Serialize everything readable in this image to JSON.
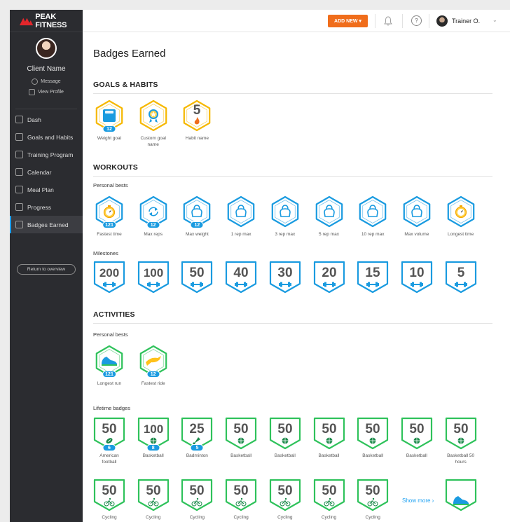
{
  "brand": {
    "name": "PEAK FITNESS",
    "color": "#e3262b"
  },
  "client": {
    "name": "Client Name",
    "message": "Message",
    "view_profile": "View Profile"
  },
  "nav": [
    {
      "label": "Dash",
      "icon": "rocket-icon"
    },
    {
      "label": "Goals and Habits",
      "icon": "target-icon"
    },
    {
      "label": "Training Program",
      "icon": "clipboard-icon"
    },
    {
      "label": "Calendar",
      "icon": "calendar-icon"
    },
    {
      "label": "Meal Plan",
      "icon": "utensils-icon"
    },
    {
      "label": "Progress",
      "icon": "chart-icon"
    },
    {
      "label": "Badges Earned",
      "icon": "grid-icon"
    }
  ],
  "return_label": "Return to overview",
  "topbar": {
    "add_new": "ADD NEW ▾",
    "help": "?",
    "trainer": "Trainer O.",
    "chevron": "⌄"
  },
  "page_title": "Badges Earned",
  "colors": {
    "blue": "#1a9be0",
    "yellow": "#f6b800",
    "green": "#2fc25b",
    "orange": "#f06d1b"
  },
  "goals": {
    "heading": "GOALS & HABITS",
    "badges": [
      {
        "label": "Weight goal",
        "icon": "scale-icon",
        "count": "12"
      },
      {
        "label": "Custom goal name",
        "icon": "award-icon",
        "count": ""
      },
      {
        "label": "Habit name",
        "icon": "flame-icon",
        "number": "5"
      }
    ]
  },
  "workouts": {
    "heading": "WORKOUTS",
    "personal_heading": "Personal bests",
    "personal": [
      {
        "label": "Fastest time",
        "icon": "stopwatch-icon",
        "count": "121"
      },
      {
        "label": "Max reps",
        "icon": "repeat-icon",
        "count": "12"
      },
      {
        "label": "Max weight",
        "icon": "kettlebell-icon",
        "count": "12"
      },
      {
        "label": "1 rep max",
        "icon": "kettlebell-icon"
      },
      {
        "label": "3 rep max",
        "icon": "kettlebell-icon"
      },
      {
        "label": "5 rep max",
        "icon": "kettlebell-icon"
      },
      {
        "label": "10 rep max",
        "icon": "kettlebell-icon"
      },
      {
        "label": "Max volume",
        "icon": "kettlebell-icon"
      },
      {
        "label": "Longest time",
        "icon": "stopwatch-icon"
      }
    ],
    "milestones_heading": "Milestones",
    "milestones": [
      "200",
      "100",
      "50",
      "40",
      "30",
      "20",
      "15",
      "10",
      "5"
    ]
  },
  "activities": {
    "heading": "ACTIVITIES",
    "personal_heading": "Personal bests",
    "personal": [
      {
        "label": "Longest run",
        "icon": "shoe-icon",
        "count": "121"
      },
      {
        "label": "Fastest ride",
        "icon": "cheetah-icon",
        "count": "12"
      }
    ],
    "lifetime_heading": "Lifetime badges",
    "lifetime_row1": [
      {
        "number": "50",
        "label": "American football",
        "icon": "football-icon",
        "count": "6"
      },
      {
        "number": "100",
        "label": "Basketball",
        "icon": "basketball-icon",
        "count": "8"
      },
      {
        "number": "25",
        "label": "Badminton",
        "icon": "shuttlecock-icon",
        "count": "5"
      },
      {
        "number": "50",
        "label": "Basketball",
        "icon": "basketball-icon"
      },
      {
        "number": "50",
        "label": "Basketball",
        "icon": "basketball-icon"
      },
      {
        "number": "50",
        "label": "Basketball",
        "icon": "basketball-icon"
      },
      {
        "number": "50",
        "label": "Basketball",
        "icon": "basketball-icon"
      },
      {
        "number": "50",
        "label": "Basketball",
        "icon": "basketball-icon"
      },
      {
        "number": "50",
        "label": "Basketball 50 hours",
        "icon": "basketball-icon"
      }
    ],
    "lifetime_row2": [
      {
        "number": "50",
        "label": "Cycling",
        "icon": "bike-icon"
      },
      {
        "number": "50",
        "label": "Cycling",
        "icon": "bike-icon"
      },
      {
        "number": "50",
        "label": "Cycling",
        "icon": "bike-icon"
      },
      {
        "number": "50",
        "label": "Cycling",
        "icon": "bike-icon"
      },
      {
        "number": "50",
        "label": "Cycling",
        "icon": "bike-icon"
      },
      {
        "number": "50",
        "label": "Cycling",
        "icon": "bike-icon"
      },
      {
        "number": "50",
        "label": "Cycling",
        "icon": "bike-icon"
      }
    ],
    "show_more": "Show more  ›"
  }
}
